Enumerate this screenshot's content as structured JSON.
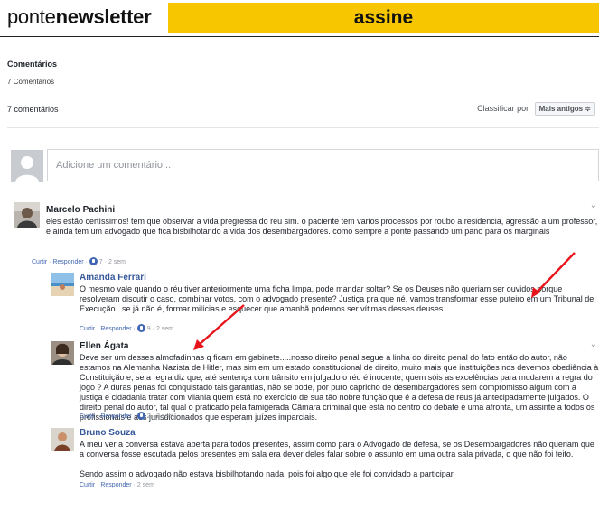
{
  "header": {
    "brand_prefix": "ponte",
    "brand_bold": "newsletter",
    "cta": "assine",
    "cta_color": "#f7c600"
  },
  "section": {
    "title": "Comentários",
    "count_label": "7 Comentários"
  },
  "list_header": {
    "count": "7 comentários",
    "sort_label": "Classificar por",
    "sort_value": "Mais antigos ≑"
  },
  "compose": {
    "placeholder": "Adicione um comentário..."
  },
  "comments": [
    {
      "author": "Marcelo Pachini",
      "text": "eles estão certíssimos! tem que observar a vida pregressa do reu sim. o paciente tem varios processos por roubo a residencia, agressão a um professor, e ainda tem um advogado que fica bisbilhotando a vida dos desembargadores. como sempre a ponte passando um pano para os marginais",
      "like": "Curtir",
      "reply": "Responder",
      "likes": "7",
      "time": "2 sem"
    },
    {
      "author": "Amanda Ferrari",
      "text": "O mesmo vale quando o réu tiver anteriormente uma ficha limpa, pode mandar soltar? Se os Deuses não queriam ser ouvidos porque resolveram discutir o caso, combinar votos, com o advogado presente? Justiça pra que né, vamos transformar esse puteiro em um Tribunal de Execução...se já não é, formar milícias e esquecer que amanhã podemos ser vítimas desses deuses.",
      "like": "Curtir",
      "reply": "Responder",
      "likes": "9",
      "time": "2 sem"
    },
    {
      "author": "Ellen Ágata",
      "text": "Deve ser um desses almofadinhas q ficam em gabinete.....nosso direito penal segue a linha do direito penal do fato então do autor, não estamos na Alemanha Nazista de Hitler, mas sim em um estado constitucional de direito, muito mais que instituições nos devemos obediência à Constituição e, se a regra diz que, até sentença com trânsito em julgado o réu é inocente, quem sóis as excelências para mudarem a regra do jogo ? A duras penas foi conquistado tais garantias, não se pode, por puro capricho de desembargadores sem compromisso algum com a justiça e cidadania tratar com vilania quem está no exercício de sua tão nobre função que é a defesa de reus já antecipadamente julgados. O direito penal do autor, tal qual o praticado pela famigerada Câmara criminal que está no centro do debate é uma afronta, um assinte a todos os profissionais e aos jurisdicionados que esperam juízes imparciais.",
      "like": "Curtir",
      "reply": "Responder",
      "likes": "2",
      "time": "2 sem"
    },
    {
      "author": "Bruno Souza",
      "text": "A meu ver a conversa estava aberta para todos presentes, assim como para o Advogado de defesa, se os Desembargadores não queriam que a conversa fosse escutada pelos presentes em sala era dever deles falar sobre o assunto em uma outra sala privada, o que não foi feito.",
      "text2": "Sendo assim o advogado não estava bisbilhotando nada, pois foi algo que ele foi convidado a participar",
      "like": "Curtir",
      "reply": "Responder",
      "time": "2 sem"
    }
  ],
  "colors": {
    "link": "#4267b2",
    "arrow": "#e8141b"
  },
  "icons": [
    "user-placeholder-icon",
    "like-icon",
    "chevron-down-icon",
    "red-arrow-annotation"
  ]
}
